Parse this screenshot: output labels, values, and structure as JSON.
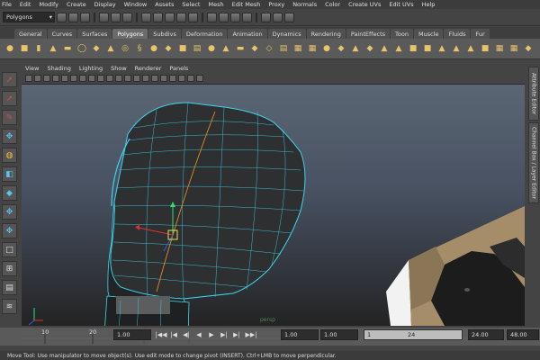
{
  "menu": [
    "File",
    "Edit",
    "Modify",
    "Create",
    "Display",
    "Window",
    "Assets",
    "Select",
    "Mesh",
    "Edit Mesh",
    "Proxy",
    "Normals",
    "Color",
    "Create UVs",
    "Edit UVs",
    "Help"
  ],
  "status_line": {
    "mode": "Polygons"
  },
  "shelf_tabs": [
    "General",
    "Curves",
    "Surfaces",
    "Polygons",
    "Subdivs",
    "Deformation",
    "Animation",
    "Dynamics",
    "Rendering",
    "PaintEffects",
    "Toon",
    "Muscle",
    "Fluids",
    "Fur"
  ],
  "active_shelf_tab": "Polygons",
  "panel_menu": [
    "View",
    "Shading",
    "Lighting",
    "Show",
    "Renderer",
    "Panels"
  ],
  "viewport": {
    "camera_label": "persp"
  },
  "right_dock": {
    "attribute_editor": "Attribute Editor",
    "channel_box": "Channel Box / Layer Editor"
  },
  "time_slider": {
    "ticks": [
      "10",
      "20"
    ]
  },
  "range": {
    "start_time": "1.00",
    "current_time": "1.00",
    "start_range": "1.00",
    "range_left": "1",
    "range_right": "24",
    "end_range": "24.00",
    "end_time": "48.00"
  },
  "playback_buttons": [
    "|◀◀",
    "|◀",
    "◀|",
    "◀",
    "▶",
    "▶|",
    "▶|",
    "▶▶|"
  ],
  "help_line": "Move Tool: Use manipulator to move object(s). Use edit mode to change pivot (INSERT).  Ctrl+LMB to move perpendicular."
}
